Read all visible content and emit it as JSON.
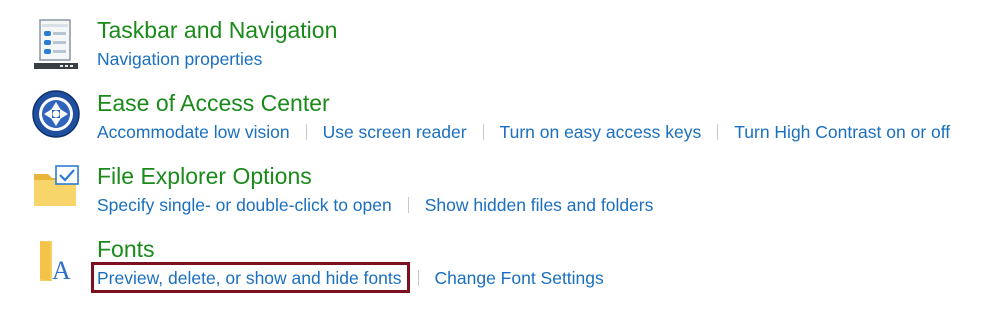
{
  "colors": {
    "title": "#1a8a1a",
    "link": "#1a6fbf",
    "highlight": "#7a1020"
  },
  "categories": [
    {
      "title": "Taskbar and Navigation",
      "icon": "taskbar-icon",
      "links": [
        "Navigation properties"
      ]
    },
    {
      "title": "Ease of Access Center",
      "icon": "ease-of-access-icon",
      "links": [
        "Accommodate low vision",
        "Use screen reader",
        "Turn on easy access keys",
        "Turn High Contrast on or off"
      ]
    },
    {
      "title": "File Explorer Options",
      "icon": "folder-check-icon",
      "links": [
        "Specify single- or double-click to open",
        "Show hidden files and folders"
      ]
    },
    {
      "title": "Fonts",
      "icon": "fonts-folder-icon",
      "icon_letter": "A",
      "links": [
        "Preview, delete, or show and hide fonts",
        "Change Font Settings"
      ]
    }
  ]
}
